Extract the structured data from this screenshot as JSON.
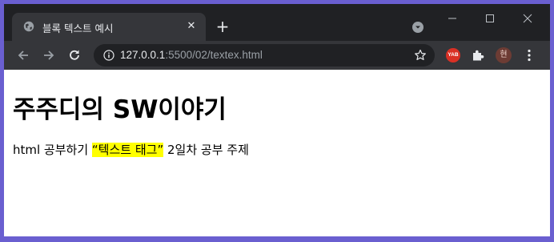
{
  "browser": {
    "tab": {
      "title": "블록 텍스트 예시",
      "close_glyph": "✕",
      "favicon": "globe-icon"
    },
    "new_tab_glyph": "+",
    "address_bar": {
      "host": "127.0.0.1",
      "path": ":5500/02/textex.html"
    },
    "extensions": {
      "yab_label": "YAB",
      "profile_initial": "현"
    },
    "colors": {
      "titlebar": "#202124",
      "toolbar": "#35363a",
      "accent_border": "#6a5fd0"
    }
  },
  "page": {
    "heading": "주주디의 SW이야기",
    "paragraph": {
      "before": "html 공부하기 ",
      "highlight": "“텍스트 태그”",
      "after": " 2일차 공부 주제",
      "highlight_color": "#ffff00"
    }
  }
}
